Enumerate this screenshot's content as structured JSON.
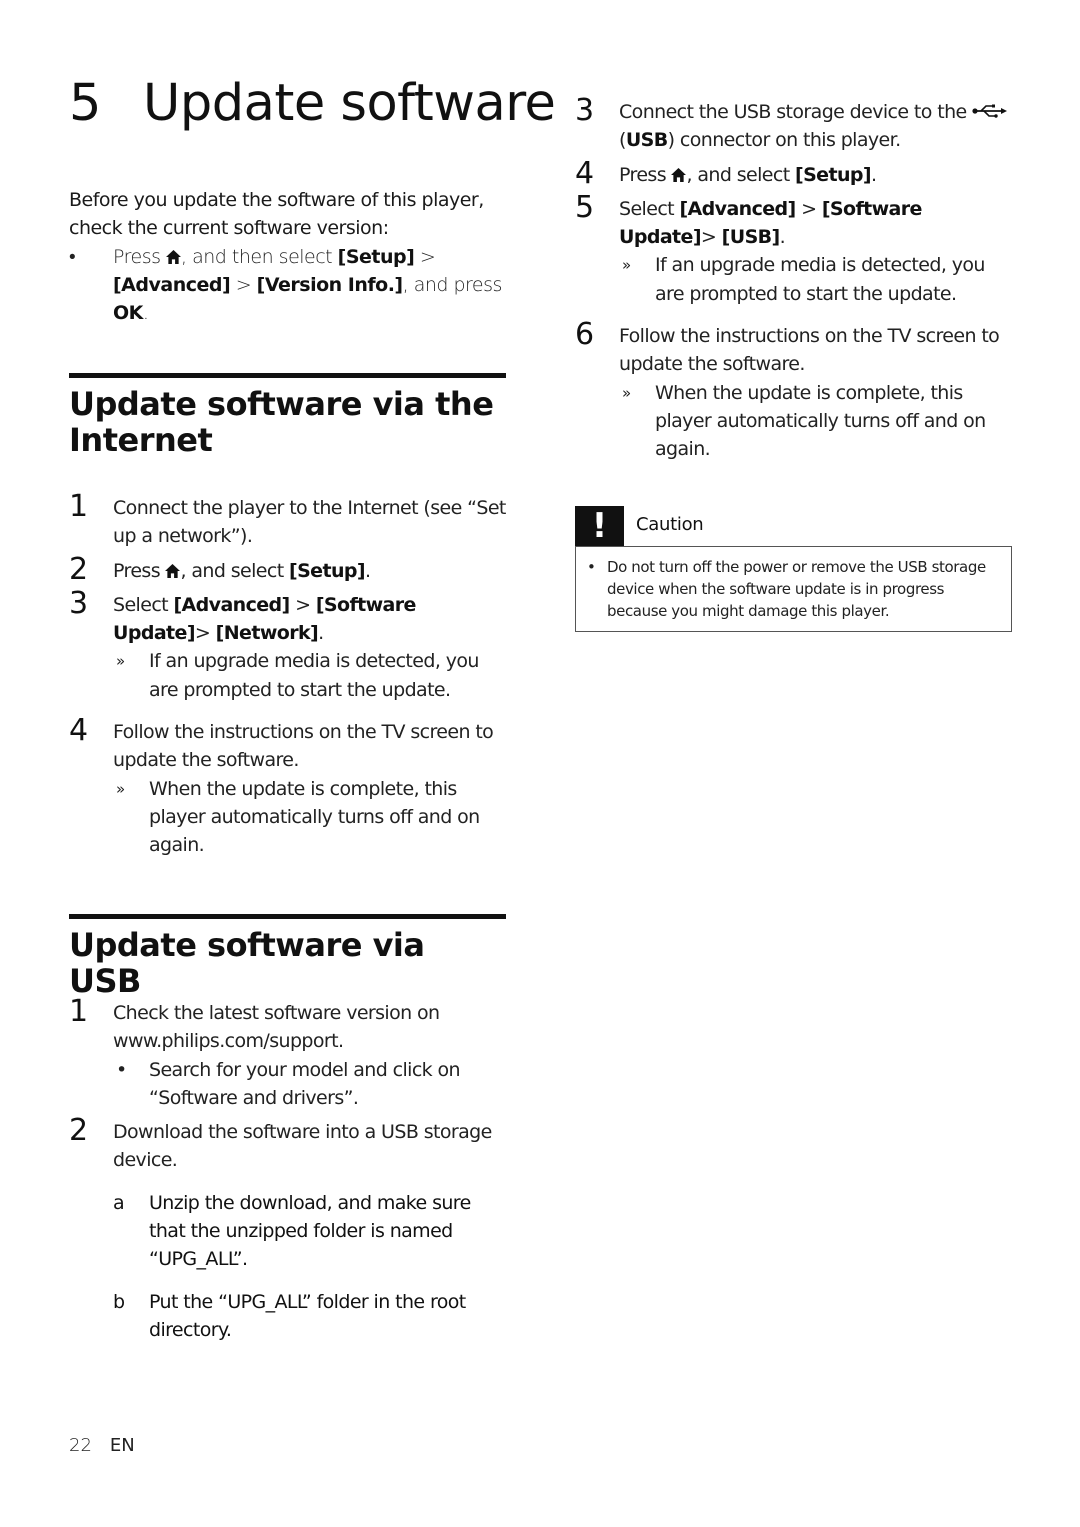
{
  "chapter": {
    "number": "5",
    "title": "Update software"
  },
  "intro": {
    "text": "Before you update the software of this player, check the current software version:",
    "bullet": {
      "mark": "•",
      "parts": [
        "Press ",
        ", and then select ",
        "[Setup]",
        " > ",
        "[Advanced]",
        " > ",
        "[Version Info.]",
        ", and press ",
        "OK",
        "."
      ]
    }
  },
  "internet": {
    "title": "Update software via the Internet",
    "steps": [
      {
        "num": "1",
        "text": "Connect the player to the Internet (see “Set up a network”)."
      },
      {
        "num": "2",
        "parts": [
          "Press ",
          ", and select ",
          "[Setup]",
          "."
        ]
      },
      {
        "num": "3",
        "parts": [
          "Select ",
          "[Advanced]",
          " > ",
          "[Software Update]",
          "> ",
          "[Network]",
          "."
        ],
        "result": {
          "mark": "»",
          "text": "If an upgrade media is detected, you are prompted to start the update."
        }
      },
      {
        "num": "4",
        "text": "Follow the instructions on the TV screen to update the software.",
        "result": {
          "mark": "»",
          "text": "When the update is complete, this player automatically turns off and on again."
        }
      }
    ]
  },
  "usb": {
    "title": "Update software via USB",
    "steps": [
      {
        "num": "1",
        "text": "Check the latest software version on www.philips.com/support.",
        "bullet": {
          "mark": "•",
          "text": "Search for your model and click on “Software and drivers”."
        }
      },
      {
        "num": "2",
        "text": "Download the software into a USB storage device.",
        "substeps": [
          {
            "mark": "a",
            "text": "Unzip the download, and make sure that the unzipped folder is named “UPG_ALL”."
          },
          {
            "mark": "b",
            "text": "Put the “UPG_ALL” folder in the root directory."
          }
        ]
      },
      {
        "num": "3",
        "parts": [
          "Connect the USB storage device to the ",
          " (",
          "USB",
          ") connector on this player."
        ]
      },
      {
        "num": "4",
        "parts": [
          "Press ",
          ", and select ",
          "[Setup]",
          "."
        ]
      },
      {
        "num": "5",
        "parts": [
          "Select ",
          "[Advanced]",
          " > ",
          "[Software Update]",
          "> ",
          "[USB]",
          "."
        ],
        "result": {
          "mark": "»",
          "text": "If an upgrade media is detected, you are prompted to start the update."
        }
      },
      {
        "num": "6",
        "text": "Follow the instructions on the TV screen to update the software.",
        "result": {
          "mark": "»",
          "text": "When the update is complete, this player automatically turns off and on again."
        }
      }
    ]
  },
  "caution": {
    "icon": "!",
    "label": "Caution",
    "bullet": "•",
    "text": "Do not turn off the power or remove the USB storage device when the software update is in progress because you might damage this player."
  },
  "footer": {
    "page": "22",
    "lang": "EN"
  }
}
